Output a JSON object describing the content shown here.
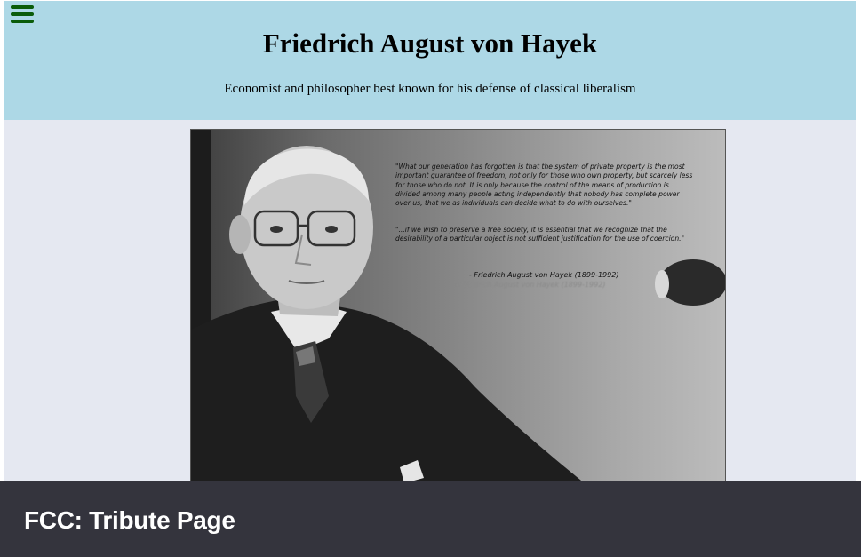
{
  "header": {
    "title": "Friedrich August von Hayek",
    "subtitle": "Economist and philosopher best known for his defense of classical liberalism",
    "menu_icon": "hamburger-menu-icon"
  },
  "image": {
    "quote1": "\"What our generation has forgotten is that the system of private property is the most important guarantee of freedom, not only for those who own property, but scarcely less for those who do not. It is only because the control of the means of production is divided among many people acting independently that nobody has complete power over us, that we as individuals can decide what to do with ourselves.\"",
    "quote2": "\"...if we wish to preserve a free society, it is essential that we recognize that the desirability of a particular object is not sufficient justification for the use of coercion.\"",
    "attribution": "- Friedrich August von Hayek (1899-1992)"
  },
  "footer": {
    "title": "FCC: Tribute Page"
  },
  "colors": {
    "header_bg": "#add8e6",
    "page_bg": "#e5e8f1",
    "footer_bg": "#34343d",
    "menu_icon": "#0a5c0a"
  }
}
